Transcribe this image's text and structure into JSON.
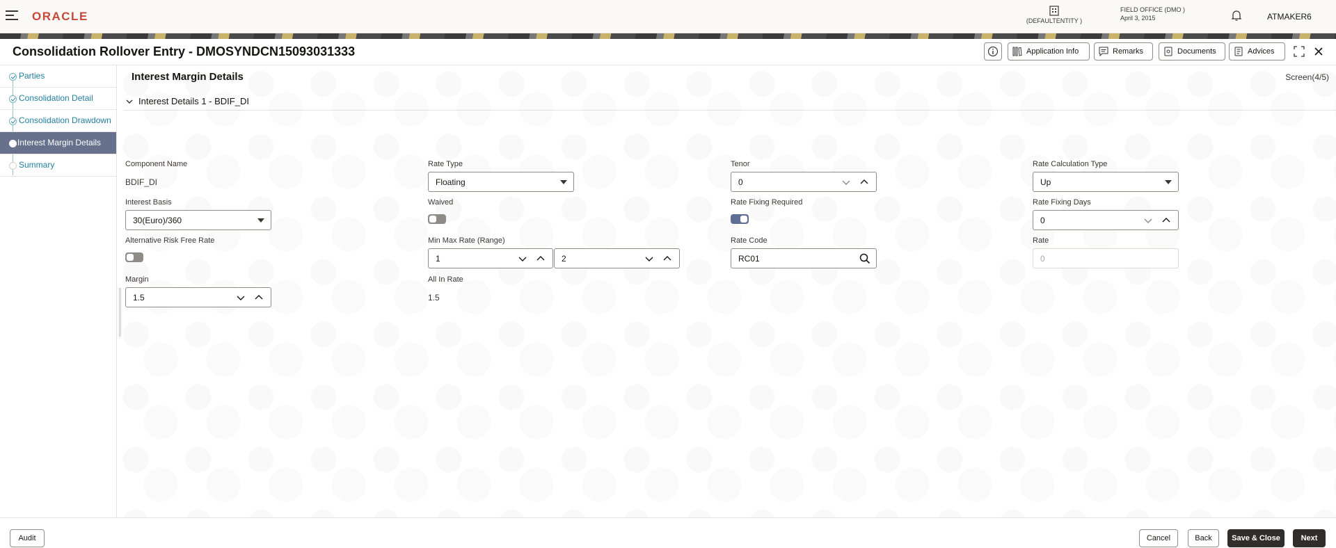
{
  "header": {
    "logo": "ORACLE",
    "entity_label": "(DEFAULTENTITY )",
    "office_name": "FIELD OFFICE  (DMO )",
    "office_date": "April 3, 2015",
    "user": "ATMAKER6"
  },
  "window": {
    "title": "Consolidation Rollover Entry - DMOSYNDCN15093031333",
    "buttons": {
      "application_info": "Application Info",
      "remarks": "Remarks",
      "documents": "Documents",
      "advices": "Advices"
    }
  },
  "nav": {
    "items": [
      {
        "label": "Parties",
        "state": "done"
      },
      {
        "label": "Consolidation Detail",
        "state": "done"
      },
      {
        "label": "Consolidation Drawdown",
        "state": "done"
      },
      {
        "label": "Interest Margin Details",
        "state": "active"
      },
      {
        "label": "Summary",
        "state": "pending"
      }
    ]
  },
  "content": {
    "title": "Interest Margin Details",
    "screen": "Screen(4/5)",
    "subsection": "Interest Details 1 - BDIF_DI",
    "fields": {
      "component_name": {
        "label": "Component Name",
        "value": "BDIF_DI"
      },
      "rate_type": {
        "label": "Rate Type",
        "value": "Floating"
      },
      "tenor": {
        "label": "Tenor",
        "value": "0"
      },
      "rate_calc_type": {
        "label": "Rate Calculation Type",
        "value": "Up"
      },
      "interest_basis": {
        "label": "Interest Basis",
        "value": "30(Euro)/360"
      },
      "waived": {
        "label": "Waived",
        "on": false
      },
      "rate_fixing_required": {
        "label": "Rate Fixing Required",
        "on": true
      },
      "rate_fixing_days": {
        "label": "Rate Fixing Days",
        "value": "0"
      },
      "alt_risk_free_rate": {
        "label": "Alternative Risk Free Rate",
        "on": false
      },
      "min_max_rate": {
        "label": "Min Max Rate (Range)",
        "min": "1",
        "max": "2"
      },
      "rate_code": {
        "label": "Rate Code",
        "value": "RC01"
      },
      "rate": {
        "label": "Rate",
        "placeholder": "0"
      },
      "margin": {
        "label": "Margin",
        "value": "1.5"
      },
      "all_in_rate": {
        "label": "All In Rate",
        "value": "1.5"
      }
    }
  },
  "footer": {
    "audit": "Audit",
    "cancel": "Cancel",
    "back": "Back",
    "save_close": "Save & Close",
    "next": "Next"
  },
  "colors": {
    "brand_red": "#c74634",
    "nav_link": "#227e9e",
    "nav_active_bg": "#67718c",
    "primary_button": "#312d2a"
  }
}
